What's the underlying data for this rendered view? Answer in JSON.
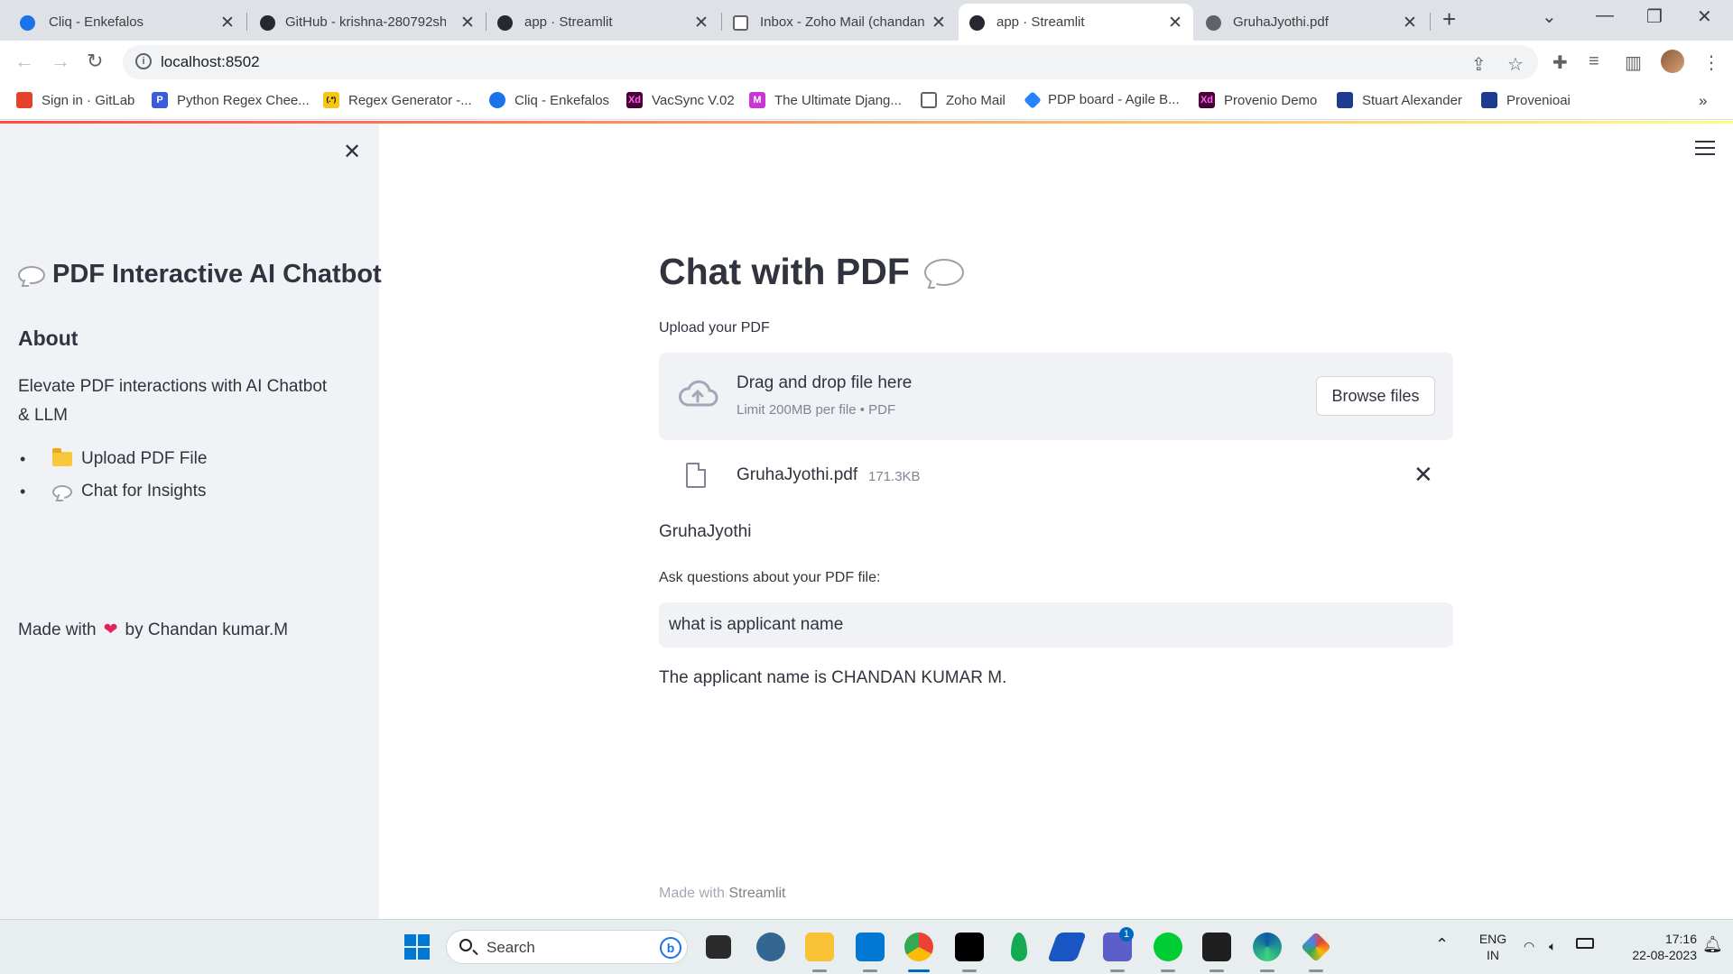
{
  "browser": {
    "tabs": [
      {
        "title": "Cliq - Enkefalos",
        "color": "#1a73e8"
      },
      {
        "title": "GitHub - krishna-280792shi",
        "color": "#24292f"
      },
      {
        "title": "app · Streamlit",
        "color": "#262730"
      },
      {
        "title": "Inbox - Zoho Mail (chandan",
        "color": "#1a73e8"
      },
      {
        "title": "app · Streamlit",
        "color": "#262730"
      },
      {
        "title": "GruhaJyothi.pdf",
        "color": "#5f6368"
      }
    ],
    "url": "localhost:8502",
    "bookmarks": [
      {
        "label": "Sign in · GitLab",
        "color": "#e24329",
        "glyph": ""
      },
      {
        "label": "Python Regex Chee...",
        "color": "#3b5bdb",
        "glyph": "P"
      },
      {
        "label": "Regex Generator -...",
        "color": "#f5c518",
        "glyph": "(.*)"
      },
      {
        "label": "Cliq - Enkefalos",
        "color": "#1a73e8",
        "glyph": ""
      },
      {
        "label": "VacSync V.02",
        "color": "#470137",
        "glyph": "Xd"
      },
      {
        "label": "The Ultimate Djang...",
        "color": "#c837d6",
        "glyph": "M"
      },
      {
        "label": "Zoho Mail",
        "color": "#5f6368",
        "glyph": ""
      },
      {
        "label": "PDP board - Agile B...",
        "color": "#2684ff",
        "glyph": ""
      },
      {
        "label": "Provenio Demo",
        "color": "#470137",
        "glyph": "Xd"
      },
      {
        "label": "Stuart Alexander",
        "color": "#1f3b8f",
        "glyph": ""
      },
      {
        "label": "Provenioai",
        "color": "#1f3b8f",
        "glyph": ""
      }
    ]
  },
  "sidebar": {
    "title": "PDF Interactive AI Chatbot",
    "about_heading": "About",
    "description": "Elevate PDF interactions with AI Chatbot & LLM",
    "items": [
      {
        "label": "Upload PDF File"
      },
      {
        "label": "Chat for Insights"
      }
    ],
    "made_with_prefix": "Made with",
    "made_with_suffix": "by Chandan kumar.M"
  },
  "main": {
    "title": "Chat with PDF",
    "upload_label": "Upload your PDF",
    "dropzone_text": "Drag and drop file here",
    "dropzone_limit": "Limit 200MB per file • PDF",
    "browse_label": "Browse files",
    "file_name": "GruhaJyothi.pdf",
    "file_size": "171.3KB",
    "doc_title": "GruhaJyothi",
    "question_label": "Ask questions about your PDF file:",
    "question_value": "what is applicant name",
    "answer": "The applicant name is CHANDAN KUMAR M.",
    "footer_prefix": "Made with",
    "footer_link": "Streamlit"
  },
  "taskbar": {
    "search_label": "Search",
    "lang": "ENG",
    "region": "IN",
    "time": "17:16",
    "date": "22-08-2023",
    "teams_badge": "1"
  }
}
